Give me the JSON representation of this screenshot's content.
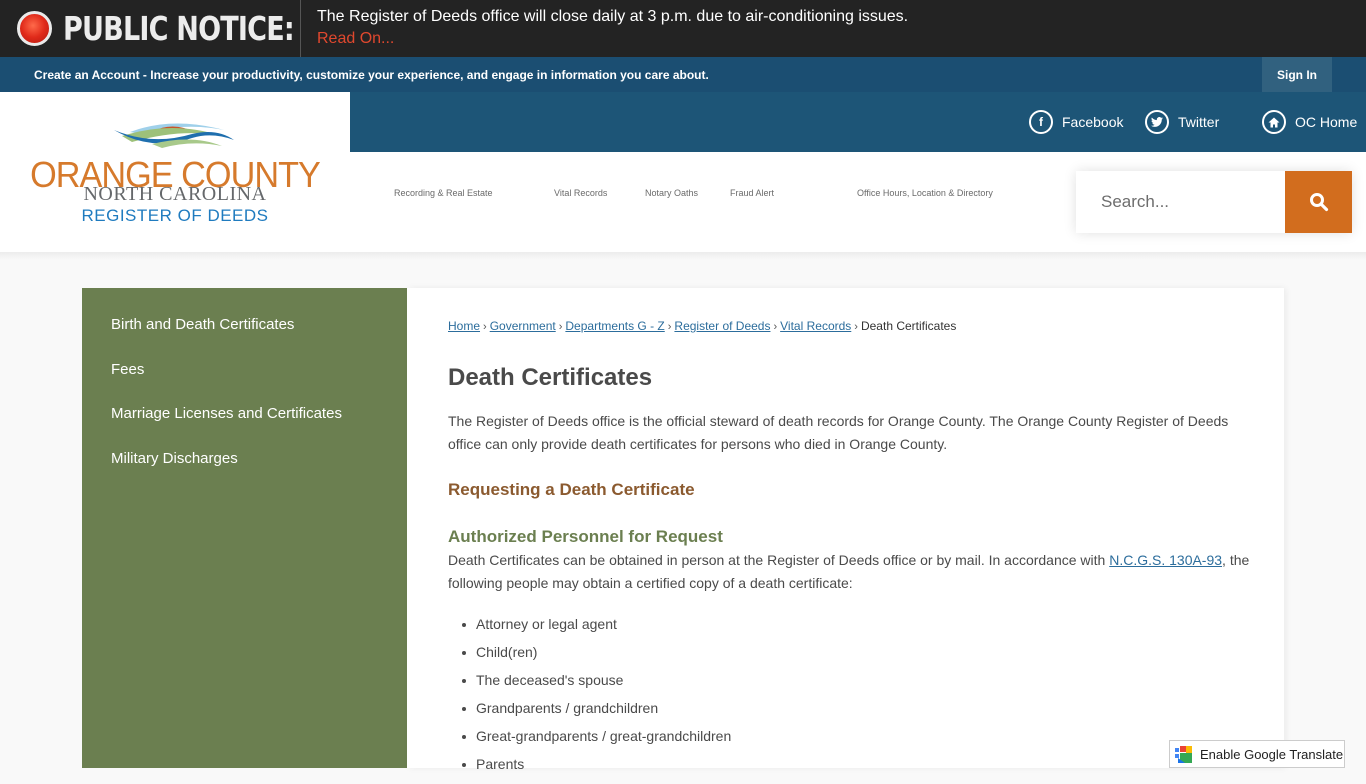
{
  "notice": {
    "label": "PUBLIC NOTICE:",
    "message": "The Register of Deeds office will close daily at 3 p.m. due to air-conditioning issues.",
    "link": "Read On..."
  },
  "account_bar": {
    "text": "Create an Account - Increase your productivity, customize your experience, and engage in information you care about.",
    "sign_in": "Sign In"
  },
  "logo": {
    "title": "ORANGE COUNTY",
    "subtitle": "NORTH CAROLINA",
    "department": "REGISTER OF DEEDS"
  },
  "social": [
    {
      "label": "Facebook",
      "icon": "facebook-icon"
    },
    {
      "label": "Twitter",
      "icon": "twitter-icon"
    },
    {
      "label": "OC Home",
      "icon": "home-icon"
    }
  ],
  "nav": [
    "Recording & Real Estate",
    "Vital Records",
    "Notary Oaths",
    "Fraud Alert",
    "Office Hours, Location & Directory"
  ],
  "search": {
    "placeholder": "Search...",
    "value": ""
  },
  "sidebar": [
    "Birth and Death Certificates",
    "Fees",
    "Marriage Licenses and Certificates",
    "Military Discharges"
  ],
  "breadcrumb": {
    "links": [
      "Home",
      "Government",
      "Departments G - Z",
      "Register of Deeds",
      "Vital Records"
    ],
    "current": "Death Certificates",
    "separator": "›"
  },
  "content": {
    "title": "Death Certificates",
    "intro": "The Register of Deeds office is the official steward of death records for Orange County. The Orange County Register of Deeds office can only provide death certificates for persons who died in Orange County.",
    "heading_request": "Requesting a Death Certificate",
    "heading_authorized": "Authorized Personnel for Request",
    "auth_text_before": "Death Certificates can be obtained in person at the Register of Deeds office or by mail. In accordance with ",
    "auth_link": "N.C.G.S. 130A-93",
    "auth_text_after": ", the following people may obtain a certified copy of a death certificate:",
    "list": [
      "Attorney or legal agent",
      "Child(ren)",
      "The deceased's spouse",
      "Grandparents / grandchildren",
      "Great-grandparents / great-grandchildren",
      "Parents"
    ]
  },
  "translate": {
    "label": "Enable Google Translate"
  },
  "colors": {
    "notice_bg": "#232323",
    "account_bg": "#1b4e72",
    "social_bg": "#1d5577",
    "accent_orange": "#d26d1e",
    "sidebar_green": "#6b7f50",
    "link_blue": "#2c6d9c"
  }
}
